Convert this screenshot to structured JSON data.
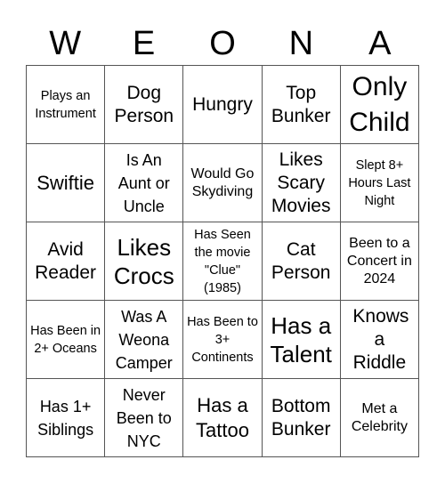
{
  "title_letters": [
    "W",
    "E",
    "O",
    "N",
    "A"
  ],
  "board": [
    [
      "Plays an Instrument",
      "Dog Person",
      "Hungry",
      "Top Bunker",
      "Only Child"
    ],
    [
      "Swiftie",
      "Is An Aunt or Uncle",
      "Would Go Skydiving",
      "Likes Scary Movies",
      "Slept 8+ Hours Last Night"
    ],
    [
      "Avid Reader",
      "Likes Crocs",
      "Has Seen the movie \"Clue\" (1985)",
      "Cat Person",
      "Been to a Concert in 2024"
    ],
    [
      "Has Been in 2+ Oceans",
      "Was A Weona Camper",
      "Has Been to 3+ Continents",
      "Has a Talent",
      "Knows a Riddle"
    ],
    [
      "Has 1+ Siblings",
      "Never Been to NYC",
      "Has a Tattoo",
      "Bottom Bunker",
      "Met a Celebrity"
    ]
  ],
  "colors": {
    "grid_line": "#555555",
    "text": "#000000",
    "background": "#ffffff"
  }
}
